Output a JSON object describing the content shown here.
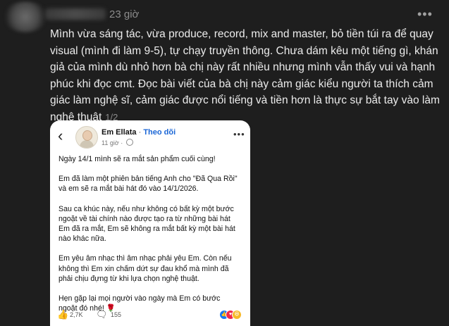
{
  "post": {
    "time_ago": "23 giờ",
    "more_icon": "more-horizontal-icon",
    "caption": "Mình vừa sáng tác, vừa produce, record, mix and master, bỏ tiền túi ra để quay visual (mình đi làm 9-5), tự chạy truyền thông. Chưa dám kêu một tiếng gì, khán giả của mình dù nhỏ hơn bà chị này rất nhiều nhưng mình vẫn thấy vui và hạnh phúc khi đọc cmt. Đọc bài viết của bà chị này cảm giác kiểu người ta thích cảm giác làm nghệ sĩ, cảm giác được nổi tiếng và tiền hơn là thực sự bắt tay vào làm nghệ thuật",
    "page_indicator": "1/2"
  },
  "embedded": {
    "back_icon": "chevron-left-icon",
    "author_name": "Em Ellata",
    "separator": "·",
    "follow_label": "Theo dõi",
    "time": "11 giờ ·",
    "paragraphs": [
      "Ngày 14/1 mình sẽ ra mắt sản phẩm cuối cùng!",
      "Em đã làm một phiên bản tiếng Anh cho \"Đã Qua Rồi\" và em sẽ ra mắt bài hát đó vào 14/1/2026.",
      "Sau ca khúc này, nếu như không có bất kỳ một bước ngoặt về tài chính nào được tạo ra từ những bài hát Em đã ra mắt, Em sẽ không ra mắt bất kỳ một bài hát nào khác nữa.",
      "Em yêu âm nhạc thì âm nhạc phải yêu Em. Còn nếu không thì Em xin chấm dứt sự đau khổ mà mình đã phải chịu đựng từ khi lựa chọn nghệ thuật.",
      "Hẹn gặp lại mọi người vào ngày mà Em có bước ngoặt đó nhé! 🌹"
    ],
    "like_count": "2,7K",
    "comment_count": "155",
    "like_color": "#1877f2",
    "love_color": "#f0284a",
    "haha_color": "#f7b928"
  }
}
